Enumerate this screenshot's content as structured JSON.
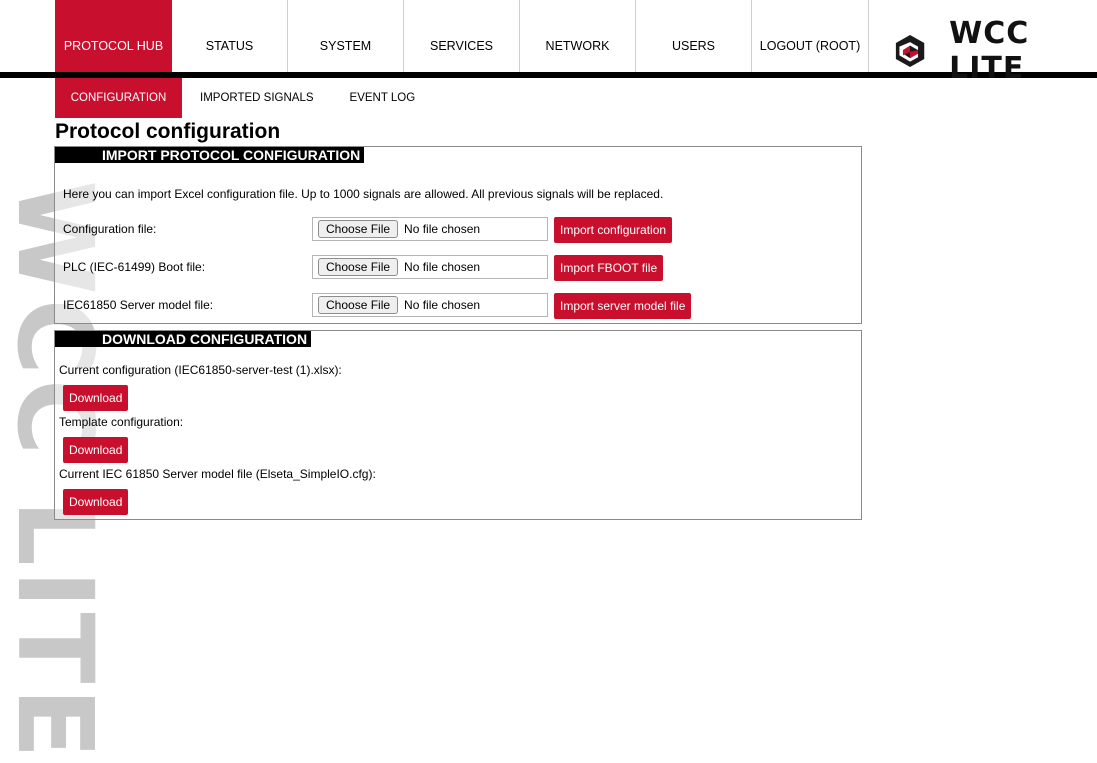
{
  "watermark": "WCC LITE",
  "logo": {
    "text": "WCC LITE"
  },
  "nav": {
    "items": [
      "PROTOCOL HUB",
      "STATUS",
      "SYSTEM",
      "SERVICES",
      "NETWORK",
      "USERS",
      "LOGOUT (ROOT)"
    ],
    "active": "PROTOCOL HUB"
  },
  "subnav": {
    "items": [
      "CONFIGURATION",
      "IMPORTED SIGNALS",
      "EVENT LOG"
    ],
    "active": "CONFIGURATION"
  },
  "page_title": "Protocol configuration",
  "import": {
    "header": "IMPORT PROTOCOL CONFIGURATION",
    "intro": "Here you can import Excel configuration file. Up to 1000 signals are allowed. All previous signals will be replaced.",
    "rows": [
      {
        "label": "Configuration file:",
        "choose": "Choose File",
        "status": "No file chosen",
        "button": "Import configuration"
      },
      {
        "label": "PLC (IEC-61499) Boot file:",
        "choose": "Choose File",
        "status": "No file chosen",
        "button": "Import FBOOT file"
      },
      {
        "label": "IEC61850 Server model file:",
        "choose": "Choose File",
        "status": "No file chosen",
        "button": "Import server model file"
      }
    ]
  },
  "download": {
    "header": "DOWNLOAD CONFIGURATION",
    "items": [
      {
        "label": "Current configuration (IEC61850-server-test (1).xlsx):",
        "button": "Download"
      },
      {
        "label": "Template configuration:",
        "button": "Download"
      },
      {
        "label": "Current IEC 61850 Server model file (Elseta_SimpleIO.cfg):",
        "button": "Download"
      }
    ]
  },
  "colors": {
    "accent": "#c8102e",
    "bar": "#000000",
    "watermark": "#c8c8c8"
  },
  "icons": {
    "logo": "wcc-logo-icon"
  }
}
